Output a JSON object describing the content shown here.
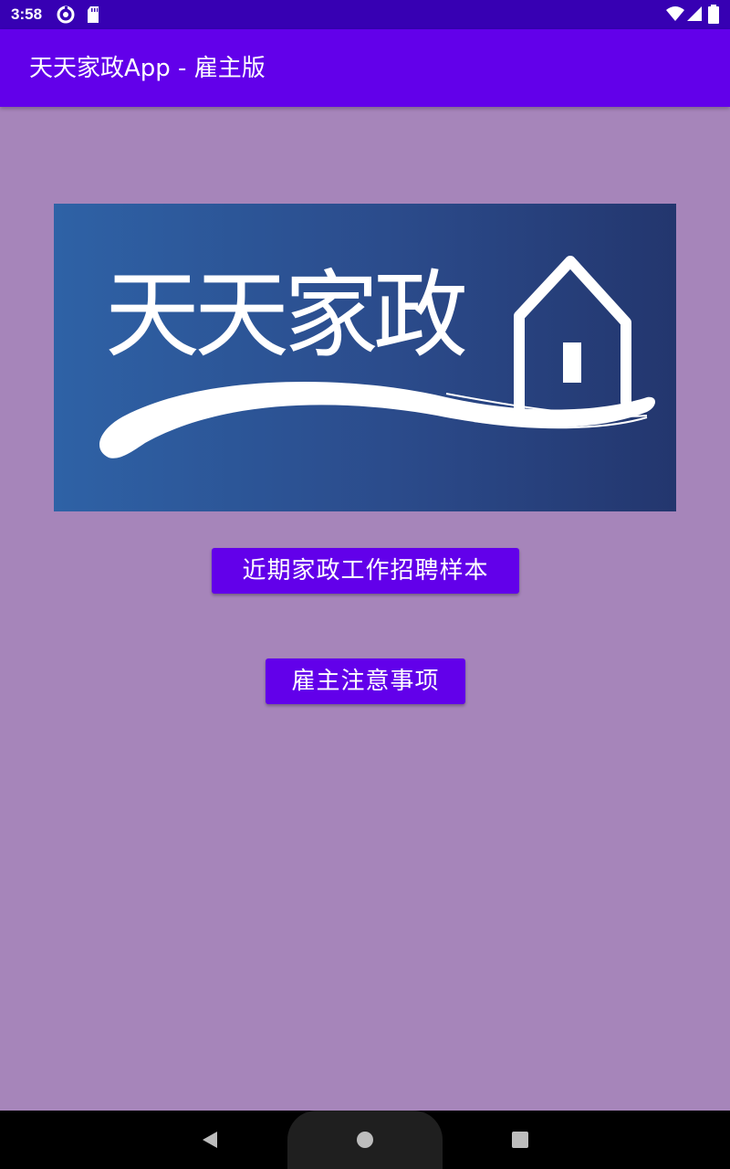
{
  "status_bar": {
    "time": "3:58",
    "left_icons": [
      "data-saver-icon",
      "sd-card-icon"
    ],
    "right_icons": [
      "wifi-icon",
      "signal-icon",
      "battery-icon"
    ]
  },
  "app_bar": {
    "title": "天天家政App - 雇主版"
  },
  "banner": {
    "logo_text": "天天家政"
  },
  "buttons": {
    "job_samples": "近期家政工作招聘样本",
    "employer_notes": "雇主注意事项"
  },
  "nav_bar": {
    "icons": [
      "back-icon",
      "home-icon",
      "recents-icon"
    ]
  },
  "colors": {
    "status_bar": "#3700b3",
    "app_bar": "#6200ea",
    "background": "#a685ba",
    "button": "#6200ea",
    "banner_start": "#2e62a6",
    "banner_end": "#23366e"
  }
}
